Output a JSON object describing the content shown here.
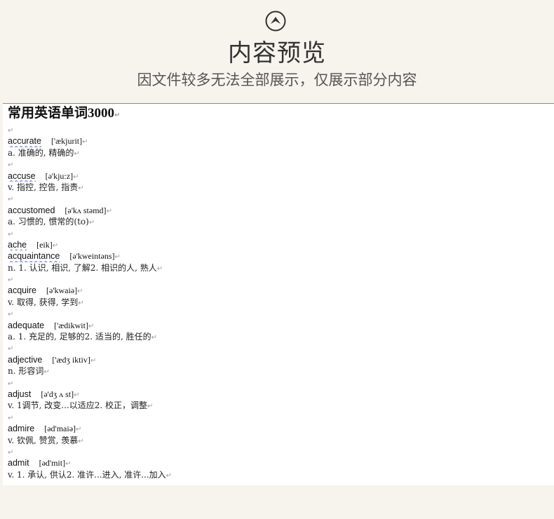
{
  "header": {
    "up_icon": "chevron-up-circle-icon",
    "title": "内容预览",
    "subtitle": "因文件较多无法全部展示，仅展示部分内容"
  },
  "document": {
    "title": "常用英语单词3000",
    "paragraph_mark": "↵",
    "entries": [
      {
        "word": "accurate",
        "phonetic": "['ækjurit]",
        "definition": "a. 准确的, 精确的",
        "spell_flag": true
      },
      {
        "word": "accuse",
        "phonetic": "[ə'kju:z]",
        "definition": "v. 指控, 控告, 指责",
        "spell_flag": true
      },
      {
        "word": "accustomed",
        "phonetic": "[ə'kʌ stəmd]",
        "definition": "a. 习惯的, 惯常的(to)",
        "spell_flag": false
      },
      {
        "word": "ache",
        "phonetic": "[eik]",
        "definition": "",
        "spell_flag": true
      },
      {
        "word": "acquaintance",
        "phonetic": "[ə'kweintəns]",
        "definition": "n. 1. 认识, 相识, 了解2. 相识的人, 熟人",
        "spell_flag": true
      },
      {
        "word": "acquire",
        "phonetic": "[ə'kwaiə]",
        "definition": "v. 取得, 获得, 学到",
        "spell_flag": false
      },
      {
        "word": "adequate",
        "phonetic": "['ædikwit]",
        "definition": "a. 1. 充足的, 足够的2. 适当的, 胜任的",
        "spell_flag": false
      },
      {
        "word": "adjective",
        "phonetic": "['ædʒ iktiv]",
        "definition": "n. 形容词",
        "spell_flag": false
      },
      {
        "word": "adjust",
        "phonetic": "[ə'dʒ ʌ st]",
        "definition": "v. 1调节, 改变...以适应2. 校正，调整",
        "spell_flag": false
      },
      {
        "word": "admire",
        "phonetic": "[əd'maiə]",
        "definition": "v. 钦佩, 赞赏, 羡慕",
        "spell_flag": false
      },
      {
        "word": "admit",
        "phonetic": "[əd'mit]",
        "definition": "v. 1. 承认, 供认2. 准许...进入, 准许...加入",
        "spell_flag": false
      }
    ]
  }
}
